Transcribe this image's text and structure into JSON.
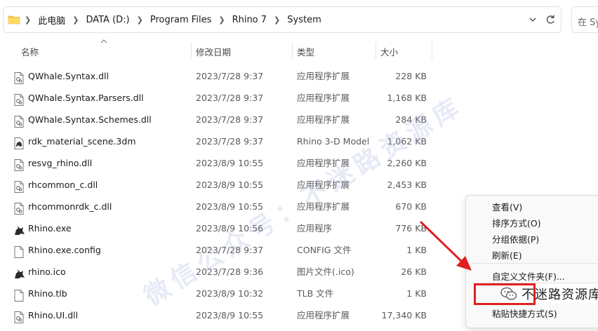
{
  "address_bar": {
    "breadcrumbs": [
      "此电脑",
      "DATA (D:)",
      "Program Files",
      "Rhino 7",
      "System"
    ],
    "search_placeholder": "在 Sys"
  },
  "columns": {
    "name": "名称",
    "date": "修改日期",
    "type": "类型",
    "size": "大小"
  },
  "files": [
    {
      "name": "QWhale.Syntax.dll",
      "date": "2023/7/28 9:37",
      "type": "应用程序扩展",
      "size": "228 KB",
      "icon": "dll-file-icon"
    },
    {
      "name": "QWhale.Syntax.Parsers.dll",
      "date": "2023/7/28 9:37",
      "type": "应用程序扩展",
      "size": "1,168 KB",
      "icon": "dll-file-icon"
    },
    {
      "name": "QWhale.Syntax.Schemes.dll",
      "date": "2023/7/28 9:37",
      "type": "应用程序扩展",
      "size": "284 KB",
      "icon": "dll-file-icon"
    },
    {
      "name": "rdk_material_scene.3dm",
      "date": "2023/7/28 9:37",
      "type": "Rhino 3-D Model",
      "size": "1,062 KB",
      "icon": "rhino-model-icon"
    },
    {
      "name": "resvg_rhino.dll",
      "date": "2023/8/9 10:55",
      "type": "应用程序扩展",
      "size": "2,260 KB",
      "icon": "dll-file-icon"
    },
    {
      "name": "rhcommon_c.dll",
      "date": "2023/8/9 10:55",
      "type": "应用程序扩展",
      "size": "2,453 KB",
      "icon": "dll-file-icon"
    },
    {
      "name": "rhcommonrdk_c.dll",
      "date": "2023/8/9 10:55",
      "type": "应用程序扩展",
      "size": "670 KB",
      "icon": "dll-file-icon"
    },
    {
      "name": "Rhino.exe",
      "date": "2023/8/9 10:56",
      "type": "应用程序",
      "size": "776 KB",
      "icon": "rhino-app-icon"
    },
    {
      "name": "Rhino.exe.config",
      "date": "2023/7/28 9:37",
      "type": "CONFIG 文件",
      "size": "1 KB",
      "icon": "blank-file-icon"
    },
    {
      "name": "rhino.ico",
      "date": "2023/7/28 9:36",
      "type": "图片文件(.ico)",
      "size": "26 KB",
      "icon": "rhino-app-icon"
    },
    {
      "name": "Rhino.tlb",
      "date": "2023/8/9 10:32",
      "type": "TLB 文件",
      "size": "1 KB",
      "icon": "blank-file-icon"
    },
    {
      "name": "Rhino.UI.dll",
      "date": "2023/8/9 10:55",
      "type": "应用程序扩展",
      "size": "17,340 KB",
      "icon": "dll-file-icon"
    }
  ],
  "context_menu": {
    "view": "查看(V)",
    "sort": "排序方式(O)",
    "group": "分组依据(P)",
    "refresh": "刷新(E)",
    "customize": "自定义文件夹(F)...",
    "paste_shortcut": "粘贴快捷方式(S)"
  },
  "watermark": {
    "text": "微信公众号：不迷路资源库",
    "brand": "不迷路资源库"
  },
  "colors": {
    "annotation_red": "#e02020",
    "folder_yellow": "#f4c542"
  }
}
